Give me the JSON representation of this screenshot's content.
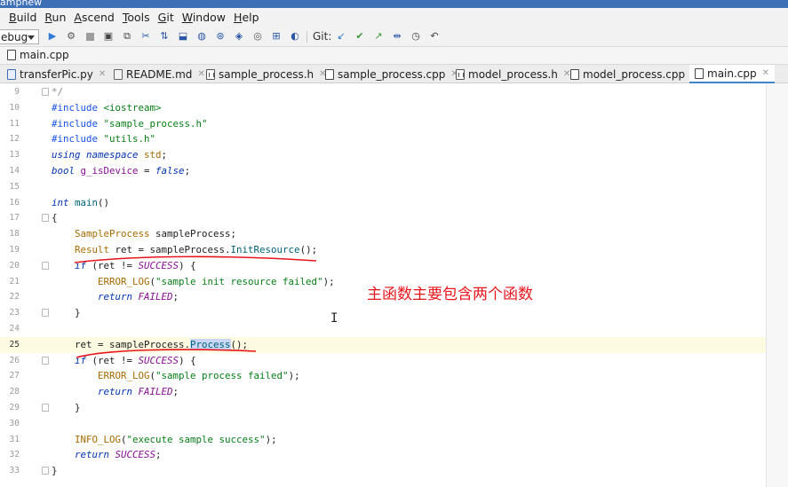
{
  "window": {
    "title": "ampnew"
  },
  "menu": [
    "Build",
    "Run",
    "Ascend",
    "Tools",
    "Git",
    "Window",
    "Help"
  ],
  "menu_mnemonics": [
    "B",
    "R",
    "A",
    "T",
    "G",
    "W",
    "H"
  ],
  "toolbar": {
    "config_value": "ebug",
    "git_label": "Git:",
    "icons": [
      "run-icon",
      "debug-icon",
      "stop-icon",
      "build-icon",
      "rebuild-icon",
      "clean-icon",
      "deploy-icon",
      "profile-icon",
      "search-icon",
      "settings-icon",
      "sync-icon",
      "camera-icon",
      "log-icon",
      "theme-icon",
      "git-update-icon",
      "git-commit-icon",
      "git-push-icon",
      "git-compare-icon",
      "git-history-icon",
      "git-rollback-icon"
    ]
  },
  "navbar": {
    "file": "main.cpp"
  },
  "tabs": [
    {
      "label": "transferPic.py",
      "icon": "py"
    },
    {
      "label": "README.md",
      "icon": "md"
    },
    {
      "label": "sample_process.h",
      "icon": "h"
    },
    {
      "label": "sample_process.cpp",
      "icon": "cpp"
    },
    {
      "label": "model_process.h",
      "icon": "h"
    },
    {
      "label": "model_process.cpp",
      "icon": "cpp"
    },
    {
      "label": "main.cpp",
      "icon": "cpp",
      "active": true
    }
  ],
  "editor": {
    "current_line": 25,
    "lines": [
      {
        "n": "9",
        "tokens": [
          [
            "cmt",
            "*/"
          ]
        ]
      },
      {
        "n": "10",
        "tokens": [
          [
            "pp",
            "#include "
          ],
          [
            "str",
            "<iostream>"
          ]
        ]
      },
      {
        "n": "11",
        "tokens": [
          [
            "pp",
            "#include "
          ],
          [
            "str",
            "\"sample_process.h\""
          ]
        ]
      },
      {
        "n": "12",
        "tokens": [
          [
            "pp",
            "#include "
          ],
          [
            "str",
            "\"utils.h\""
          ]
        ]
      },
      {
        "n": "13",
        "tokens": [
          [
            "kw",
            "using namespace "
          ],
          [
            "type",
            "std"
          ],
          [
            "",
            ";"
          ]
        ]
      },
      {
        "n": "14",
        "tokens": [
          [
            "kw",
            "bool "
          ],
          [
            "var",
            "g_isDevice"
          ],
          [
            "",
            " = "
          ],
          [
            "kw",
            "false"
          ],
          [
            "",
            ";"
          ]
        ]
      },
      {
        "n": "15",
        "tokens": []
      },
      {
        "n": "16",
        "tokens": [
          [
            "kw",
            "int "
          ],
          [
            "fn",
            "main"
          ],
          [
            "",
            "()"
          ]
        ]
      },
      {
        "n": "17",
        "tokens": [
          [
            "",
            "{"
          ]
        ]
      },
      {
        "n": "18",
        "tokens": [
          [
            "",
            "    "
          ],
          [
            "type",
            "SampleProcess "
          ],
          [
            "",
            "sampleProcess;"
          ]
        ]
      },
      {
        "n": "19",
        "tokens": [
          [
            "",
            "    "
          ],
          [
            "type",
            "Result "
          ],
          [
            "",
            "ret = sampleProcess."
          ],
          [
            "fn",
            "InitResource"
          ],
          [
            "",
            "();"
          ]
        ]
      },
      {
        "n": "20",
        "tokens": [
          [
            "",
            "    "
          ],
          [
            "kw",
            "if "
          ],
          [
            "",
            "(ret != "
          ],
          [
            "const",
            "SUCCESS"
          ],
          [
            "",
            ") {"
          ]
        ]
      },
      {
        "n": "21",
        "tokens": [
          [
            "",
            "        "
          ],
          [
            "type",
            "ERROR_LOG"
          ],
          [
            "",
            "("
          ],
          [
            "str",
            "\"sample init resource failed\""
          ],
          [
            "",
            ");"
          ]
        ]
      },
      {
        "n": "22",
        "tokens": [
          [
            "",
            "        "
          ],
          [
            "kw",
            "return "
          ],
          [
            "const",
            "FAILED"
          ],
          [
            "",
            ";"
          ]
        ]
      },
      {
        "n": "23",
        "tokens": [
          [
            "",
            "    }"
          ]
        ]
      },
      {
        "n": "24",
        "tokens": []
      },
      {
        "n": "25",
        "tokens": [
          [
            "",
            "    ret = sampleProcess."
          ],
          [
            "hl",
            "Process"
          ],
          [
            "",
            "();"
          ]
        ]
      },
      {
        "n": "26",
        "tokens": [
          [
            "",
            "    "
          ],
          [
            "kw",
            "if "
          ],
          [
            "",
            "(ret != "
          ],
          [
            "const",
            "SUCCESS"
          ],
          [
            "",
            ") {"
          ]
        ]
      },
      {
        "n": "27",
        "tokens": [
          [
            "",
            "        "
          ],
          [
            "type",
            "ERROR_LOG"
          ],
          [
            "",
            "("
          ],
          [
            "str",
            "\"sample process failed\""
          ],
          [
            "",
            ");"
          ]
        ]
      },
      {
        "n": "28",
        "tokens": [
          [
            "",
            "        "
          ],
          [
            "kw",
            "return "
          ],
          [
            "const",
            "FAILED"
          ],
          [
            "",
            ";"
          ]
        ]
      },
      {
        "n": "29",
        "tokens": [
          [
            "",
            "    }"
          ]
        ]
      },
      {
        "n": "30",
        "tokens": []
      },
      {
        "n": "31",
        "tokens": [
          [
            "",
            "    "
          ],
          [
            "type",
            "INFO_LOG"
          ],
          [
            "",
            "("
          ],
          [
            "str",
            "\"execute sample success\""
          ],
          [
            "",
            ");"
          ]
        ]
      },
      {
        "n": "32",
        "tokens": [
          [
            "",
            "    "
          ],
          [
            "kw",
            "return "
          ],
          [
            "const",
            "SUCCESS"
          ],
          [
            "",
            ";"
          ]
        ]
      },
      {
        "n": "33",
        "tokens": [
          [
            "",
            "}"
          ]
        ]
      }
    ]
  },
  "annotation": {
    "text": "主函数主要包含两个函数",
    "color": "#e8151b"
  },
  "colors": {
    "accent": "#3d6fb6",
    "tab_underline": "#4083c9",
    "annotation_red": "#e8151b"
  }
}
